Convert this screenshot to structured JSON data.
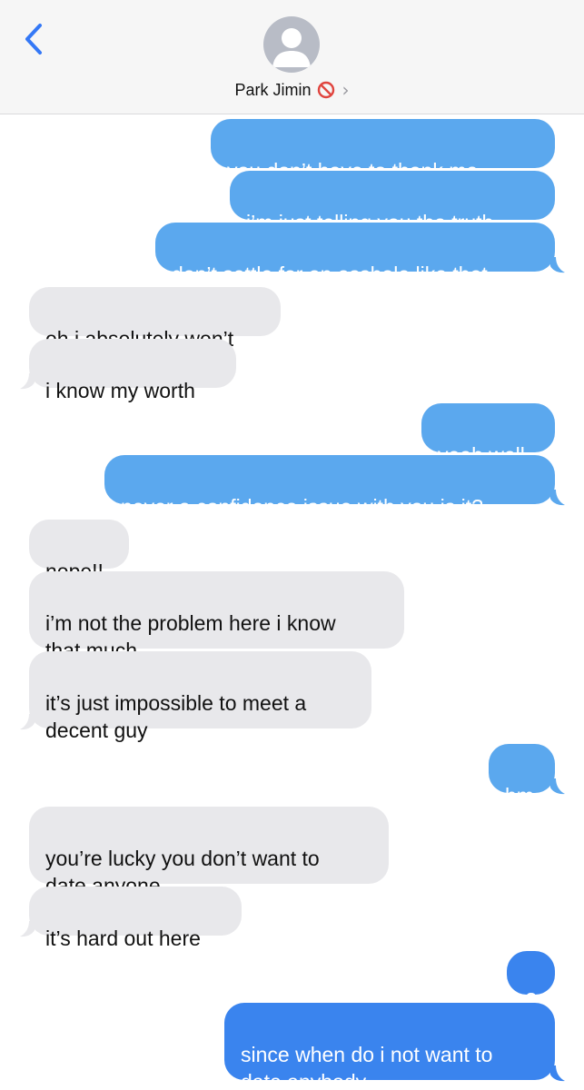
{
  "header": {
    "contact_name": "Park Jimin",
    "back_icon": "chevron-left-icon",
    "status_icon": "no-entry-icon",
    "disclosure": "›"
  },
  "colors": {
    "outgoing_bubble": "#5ba8ee",
    "outgoing_bubble_last": "#3a84ee",
    "incoming_bubble": "#e8e8eb",
    "accent": "#3478f6"
  },
  "messages": [
    {
      "from": "me",
      "text": "you don’t have to thank me"
    },
    {
      "from": "me",
      "text": "i’m just telling you the truth"
    },
    {
      "from": "me",
      "text": "don’t settle for an asshole like that"
    },
    {
      "from": "them",
      "text": "oh i absolutely won’t"
    },
    {
      "from": "them",
      "text": "i know my worth"
    },
    {
      "from": "me",
      "text": "yeah well"
    },
    {
      "from": "me",
      "text": "never a confidence issue with you is it?"
    },
    {
      "from": "them",
      "text": "nope!!"
    },
    {
      "from": "them",
      "text": "i’m not the problem here i know\nthat much"
    },
    {
      "from": "them",
      "text": "it’s just impossible to meet a\ndecent guy"
    },
    {
      "from": "me",
      "text": "hm"
    },
    {
      "from": "them",
      "text": "you’re lucky you don’t want to\ndate anyone"
    },
    {
      "from": "them",
      "text": "it’s hard out here"
    },
    {
      "from": "me",
      "text": "?"
    },
    {
      "from": "me",
      "text": "since when do i not want to\ndate anybody"
    }
  ]
}
